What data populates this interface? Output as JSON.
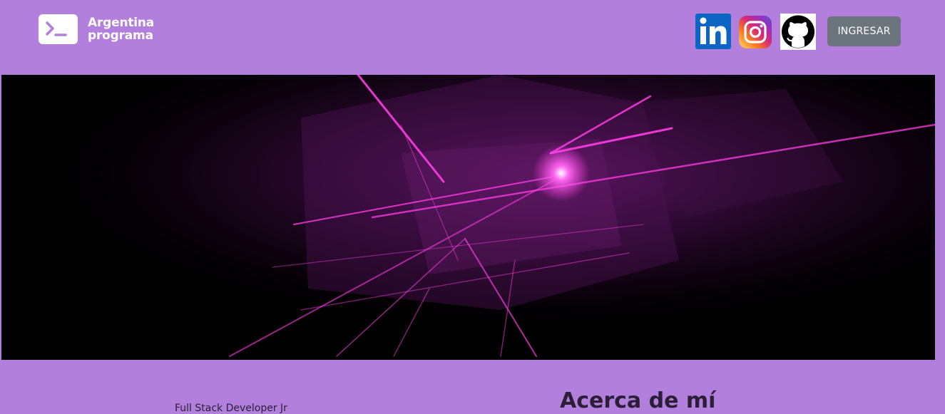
{
  "brand": {
    "name_line1": "Argentina",
    "name_line2": "programa"
  },
  "social": [
    {
      "icon": "linkedin-icon",
      "color": "#0a66c2"
    },
    {
      "icon": "instagram-icon",
      "color": "#e1306c"
    },
    {
      "icon": "github-icon",
      "color": "#000000"
    }
  ],
  "header": {
    "login_label": "INGRESAR"
  },
  "profile": {
    "subtitle": "Full Stack Developer Jr"
  },
  "about": {
    "title": "Acerca de mí"
  },
  "colors": {
    "background": "#b27fdc",
    "button": "#6c757d",
    "hero_accent": "#ff3ce6"
  }
}
